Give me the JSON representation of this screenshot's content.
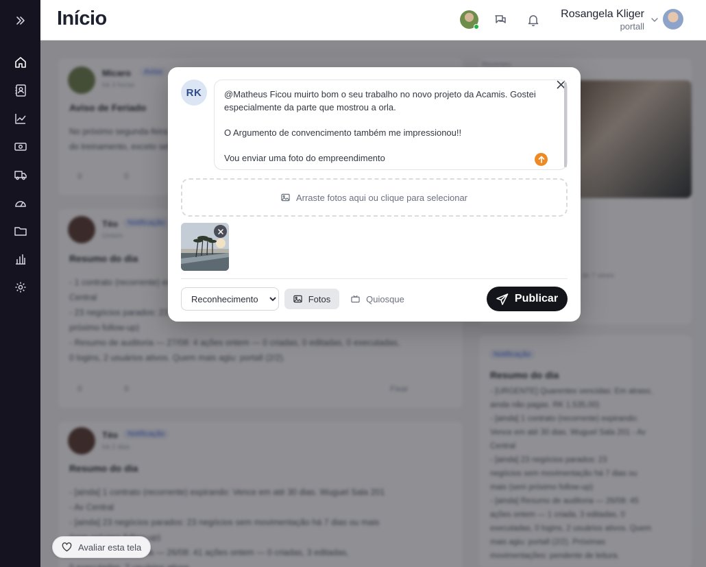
{
  "header": {
    "title": "Início",
    "user_name": "Rosangela Kliger",
    "user_org": "portall"
  },
  "sidebar": {
    "items": [
      {
        "name": "home",
        "icon": "home-icon"
      },
      {
        "name": "contacts",
        "icon": "contacts-icon"
      },
      {
        "name": "analytics",
        "icon": "line-chart-icon"
      },
      {
        "name": "finance",
        "icon": "money-icon"
      },
      {
        "name": "delivery",
        "icon": "truck-icon"
      },
      {
        "name": "dashboard",
        "icon": "gauge-icon"
      },
      {
        "name": "files",
        "icon": "folder-icon"
      },
      {
        "name": "reports",
        "icon": "bar-chart-icon"
      },
      {
        "name": "settings",
        "icon": "gear-icon"
      }
    ]
  },
  "feed": {
    "posts": [
      {
        "author": "Micaro",
        "tag": "Aviso",
        "time": "há 3 horas",
        "title": "Aviso de Feriado",
        "body": [
          "No próximo segunda-feira não haverá expediente",
          "do treinamento, exceto setores de plantão."
        ],
        "likes": "0",
        "comments": "0"
      },
      {
        "author": "Téo",
        "tag": "Notificação",
        "time": "Ontem",
        "title": "Resumo do dia",
        "body": [
          "- 1 contrato (recorrente) expirando: Vence em até 30 dias",
          "Central",
          "- 23 negócios parados: 23 negócios sem movimentação há 7 dias",
          "próximo follow-up)",
          "- Resumo de auditoria — 27/08: 4 ações ontem — 0 criadas, 0 editadas, 0 executadas,",
          "0 logins, 2 usuários ativos. Quem mais agiu: portall (2/2)."
        ],
        "likes": "0",
        "comments": "0",
        "follow": "Fixar"
      },
      {
        "author": "Téo",
        "tag": "Notificação",
        "time": "há 2 dias",
        "title": "Resumo do dia",
        "body": [
          "- [ainda] 1 contrato (recorrente) expirando: Vence em até 30 dias. Wuguel Sala 201",
          "- Av Central",
          "- [ainda] 23 negócios parados: 23 negócios sem movimentação há 7 dias ou mais",
          "(sem próximo follow-up)",
          "- Resumo de auditoria — 26/08: 41 ações ontem — 0 criadas, 3 editadas,",
          "0 executadas, 2 usuários ativos."
        ]
      }
    ],
    "side_label": "Recentes",
    "side_caption": "de 7 views",
    "side_card": {
      "tag": "Notificação",
      "title": "Resumo do dia",
      "body": [
        "- [URGENTE] Quarentes vencidas: Em atraso,",
        "ainda não pagas. RK 1.535,00)",
        "- [ainda] 1 contrato (recorrente) expirando:",
        "Vence em até 30 dias. Wuguel Sala 201 - Av",
        "Central",
        "- [ainda] 23 negócios parados: 23",
        "negócios sem movimentação há 7 dias ou",
        "mais (sem próximo follow-up)",
        "- [ainda] Resumo de auditoria — 26/08: 45",
        "ações ontem — 1 criada, 3 editadas, 0",
        "executadas, 0 logins, 2 usuários ativos. Quem",
        "mais agiu: portall (2/2). Próximas",
        "movimentações: pendente de leitura."
      ]
    }
  },
  "rate_button": {
    "label": "Avaliar esta tela"
  },
  "modal": {
    "avatar_initials": "RK",
    "text_lines": [
      "@Matheus Ficou muirto bom o seu trabalho no novo projeto da Acamis. Gostei especialmente da parte que mostrou a orla.",
      "",
      "O Argumento de convencimento também me impressionou!!",
      "",
      "Vou enviar uma foto do empreendimento"
    ],
    "dropzone_label": "Arraste fotos aqui ou clique para selecionar",
    "post_type": {
      "selected": "Reconhecimento",
      "options": [
        "Reconhecimento"
      ]
    },
    "photos_button": "Fotos",
    "kiosk_button": "Quiosque",
    "publish_button": "Publicar"
  },
  "colors": {
    "sidebar_bg": "#151320",
    "publish_bg": "#14151a",
    "avatar_initials_bg": "#dce5f4",
    "online": "#22b14c",
    "emoji_badge": "#ee8a25"
  }
}
